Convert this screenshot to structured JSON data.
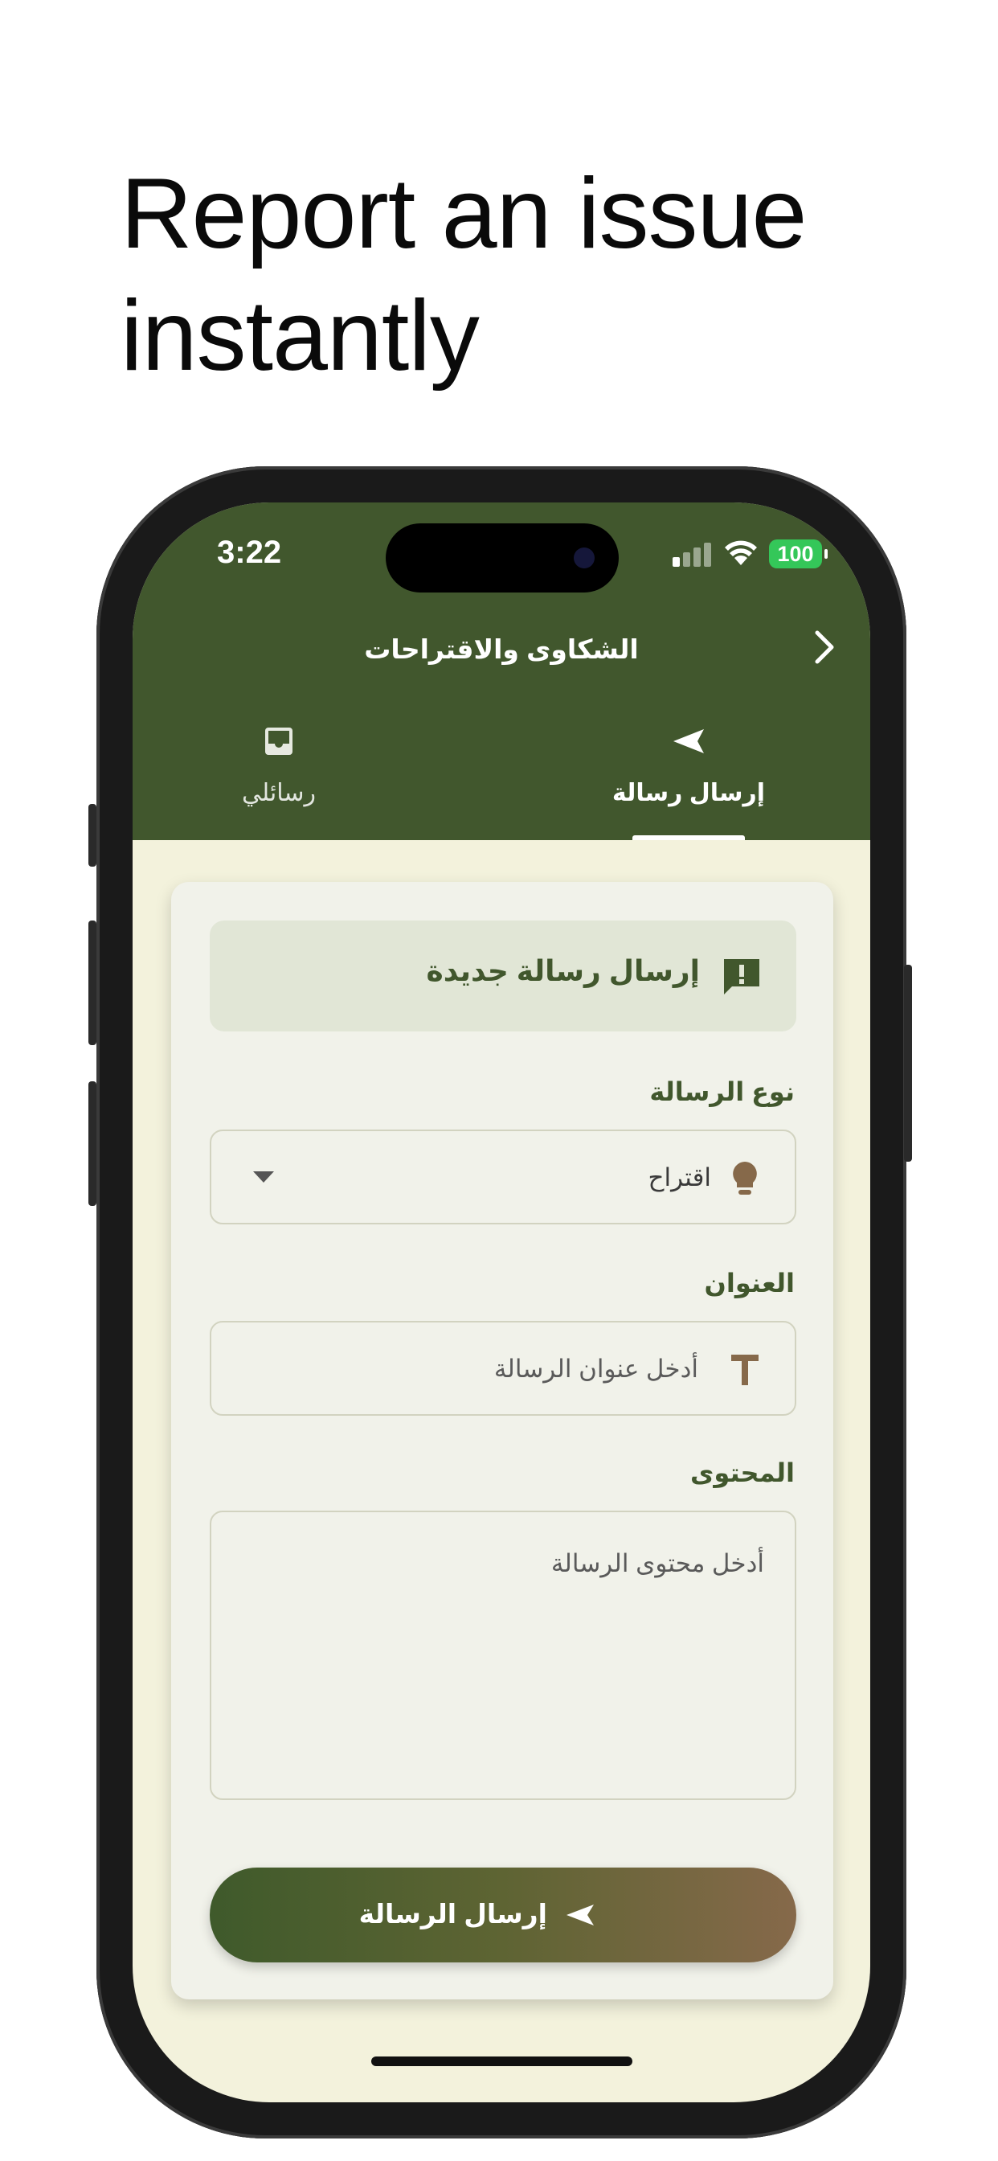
{
  "headline": "Report an issue instantly",
  "status_bar": {
    "time": "3:22",
    "battery": "100"
  },
  "nav": {
    "title": "الشكاوى والاقتراحات",
    "back_icon": "chevron-right-icon"
  },
  "tabs": [
    {
      "label": "إرسال رسالة",
      "icon": "send-icon",
      "selected": true
    },
    {
      "label": "رسائلي",
      "icon": "inbox-icon",
      "selected": false
    }
  ],
  "form": {
    "header_title": "إرسال رسالة جديدة",
    "header_icon": "feedback-icon",
    "type_label": "نوع الرسالة",
    "type_value": "اقتراح",
    "type_icon": "lightbulb-icon",
    "title_label": "العنوان",
    "title_placeholder": "أدخل عنوان الرسالة",
    "title_icon": "text-icon",
    "content_label": "المحتوى",
    "content_placeholder": "أدخل محتوى الرسالة",
    "submit_label": "إرسال الرسالة",
    "submit_icon": "send-icon"
  },
  "colors": {
    "primary": "#41572d",
    "accent": "#86694a",
    "background": "#f3f2dc",
    "card": "#f1f2ea"
  }
}
